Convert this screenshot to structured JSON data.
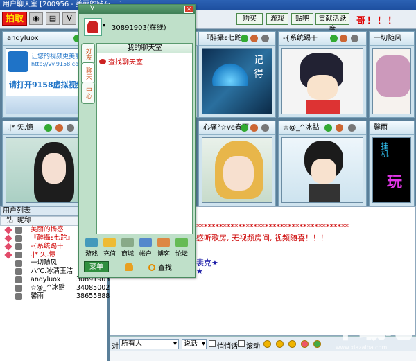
{
  "window": {
    "title": "用户聊天室 [200956 - 美丽的钻石 ...]"
  },
  "toolbar": {
    "capture_label": "拍取",
    "buttons": [
      "购买",
      "游戏",
      "贴吧",
      "贡献活跃度"
    ],
    "marquee": "哥！！！"
  },
  "video_cells": [
    {
      "name": "andyluox",
      "caption_line1": "让您的视频更美丽",
      "caption_line2": "http://vv.9158.com",
      "caption_line3": "请打开9158虚拟视频"
    },
    {
      "name": "『醉攝ε七跎』",
      "art_text": "记得"
    },
    {
      "name": "-{系统踢干",
      "art_text": ""
    },
    {
      "name": "一切随风",
      "art_text": ""
    },
    {
      "name": ".|* 矢.憶",
      "art_text": ""
    },
    {
      "name": "心痛°☆ve春雨...",
      "art_text": ""
    },
    {
      "name": "☆@_^冰點",
      "art_text": ""
    },
    {
      "name": "馨雨",
      "art_text": "挂机"
    }
  ],
  "user_list": {
    "header": "用户列表",
    "col_icon": "钻",
    "col_name": "昵称",
    "rows": [
      {
        "name": "美丽的扬感",
        "id": "",
        "red": true
      },
      {
        "name": "『醉攝ε七跎』",
        "id": "",
        "red": true
      },
      {
        "name": "-{系统踢干",
        "id": "",
        "red": true
      },
      {
        "name": ".|* 矢.憶",
        "id": "",
        "red": true
      },
      {
        "name": "一切随风",
        "id": "",
        "red": false
      },
      {
        "name": "ハ℃.冰清玉洁",
        "id": "",
        "red": false
      },
      {
        "name": "andyluox",
        "id": "30891903",
        "red": false
      },
      {
        "name": "☆@_^冰點",
        "id": "34085002",
        "red": false
      },
      {
        "name": "馨雨",
        "id": "38655888",
        "red": false
      }
    ]
  },
  "chat": {
    "line1": "****************************************",
    "line2": "感听歌房, 无视频房间, 视频随喜！！！",
    "line3": "裴克★",
    "line4": "★"
  },
  "input_bar": {
    "to_label": "对",
    "to_value": "所有人",
    "mode_value": "说话",
    "whisper_label": "悄悄话",
    "scroll_label": "滚动"
  },
  "panel": {
    "title": "V",
    "user_line": "30891903(在线)",
    "tabs": [
      "好友",
      "聊天",
      "中心"
    ],
    "inner_title": "我的聊天室",
    "find_label": "查找聊天室",
    "buttons": [
      "游戏",
      "充值",
      "商城",
      "帐户",
      "博客",
      "论坛"
    ],
    "menu_label": "菜单",
    "search_label": "查找"
  }
}
